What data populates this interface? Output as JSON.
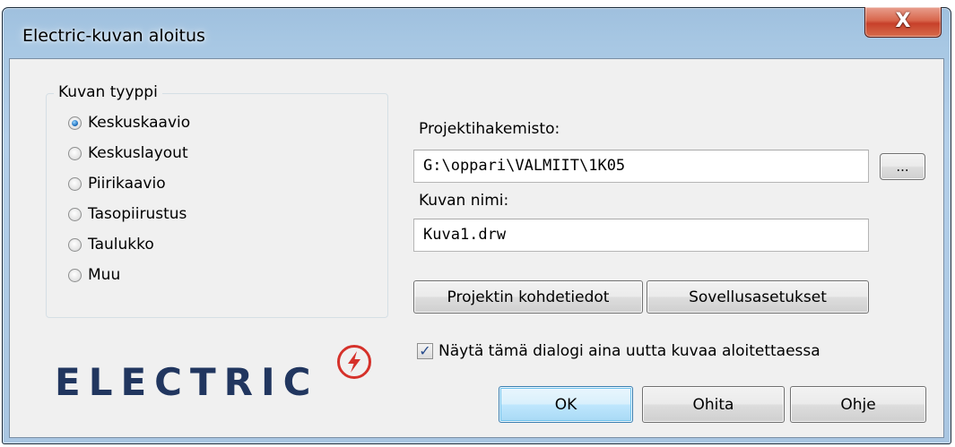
{
  "window": {
    "title": "Electric-kuvan aloitus",
    "close_label": "X"
  },
  "image_type": {
    "legend": "Kuvan tyyppi",
    "options": [
      {
        "label": "Keskuskaavio",
        "checked": true
      },
      {
        "label": "Keskuslayout",
        "checked": false
      },
      {
        "label": "Piirikaavio",
        "checked": false
      },
      {
        "label": "Tasopiirustus",
        "checked": false
      },
      {
        "label": "Taulukko",
        "checked": false
      },
      {
        "label": "Muu",
        "checked": false
      }
    ]
  },
  "project": {
    "dir_label": "Projektihakemisto:",
    "dir_value": "G:\\oppari\\VALMIIT\\1K05",
    "browse_label": "...",
    "name_label": "Kuvan nimi:",
    "name_value": "Kuva1.drw"
  },
  "buttons": {
    "project_info": "Projektin kohdetiedot",
    "app_settings": "Sovellusasetukset",
    "ok": "OK",
    "skip": "Ohita",
    "help": "Ohje"
  },
  "show_dialog": {
    "label": "Näytä tämä dialogi aina uutta kuvaa aloitettaessa",
    "checked": true
  },
  "logo": {
    "text": "ELECTRIC",
    "bolt_color": "#d5312a",
    "text_color": "#21365f"
  },
  "colors": {
    "default_button_border": "#3c7fb1",
    "close_button": "#c7402a"
  }
}
